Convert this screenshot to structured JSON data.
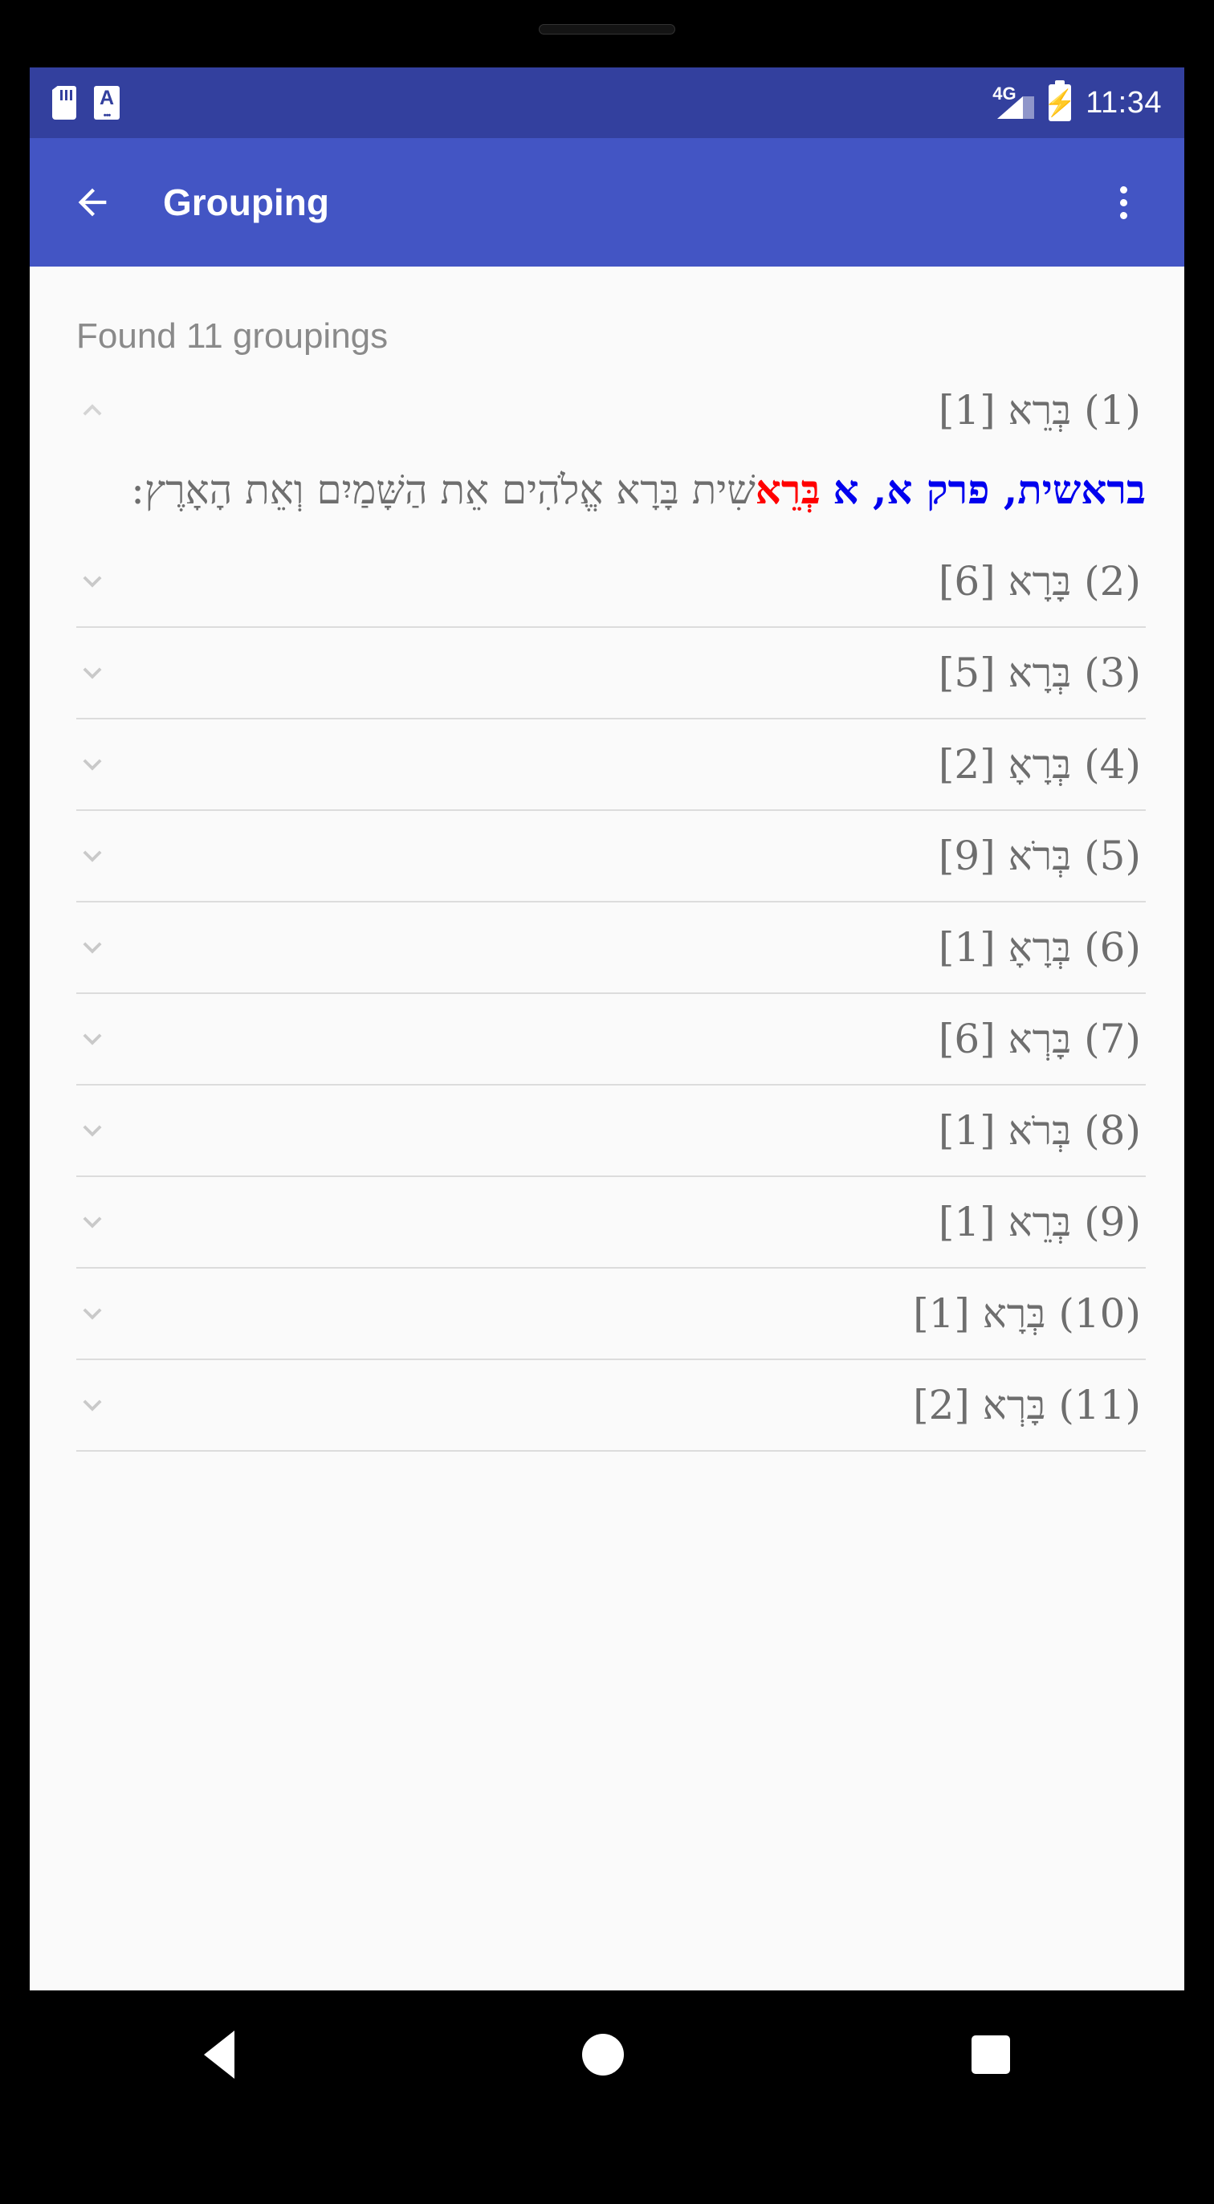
{
  "status_bar": {
    "sd_card_icon": "sd-card-icon",
    "keyboard_icon_letter": "A",
    "network_type": "4G",
    "battery_glyph": "⚡",
    "time": "11:34"
  },
  "app_bar": {
    "back_icon": "arrow-left-icon",
    "title": "Grouping",
    "overflow_icon": "more-vertical-icon"
  },
  "content": {
    "result_count_text": "Found 11 groupings"
  },
  "groupings": [
    {
      "index_label": "(1)",
      "word": "בְּרֵא",
      "count_label": "[1]",
      "expanded": true,
      "chevron": "chevron-up-icon",
      "detail": {
        "reference": "בראשית, פרק א, א",
        "highlight_word": "בְּרֵא",
        "verse_rest": "שִׁית בָּרָא אֱלֹהִים אֵת הַשָּׁמַיִם וְאֵת הָאָרֶץ:"
      }
    },
    {
      "index_label": "(2)",
      "word": "בָּרָא",
      "count_label": "[6]",
      "expanded": false,
      "chevron": "chevron-down-icon"
    },
    {
      "index_label": "(3)",
      "word": "בְּרָא",
      "count_label": "[5]",
      "expanded": false,
      "chevron": "chevron-down-icon"
    },
    {
      "index_label": "(4)",
      "word": "בְּרָאָ",
      "count_label": "[2]",
      "expanded": false,
      "chevron": "chevron-down-icon"
    },
    {
      "index_label": "(5)",
      "word": "בְּרֹא",
      "count_label": "[9]",
      "expanded": false,
      "chevron": "chevron-down-icon"
    },
    {
      "index_label": "(6)",
      "word": "בְּרָאָ",
      "count_label": "[1]",
      "expanded": false,
      "chevron": "chevron-down-icon"
    },
    {
      "index_label": "(7)",
      "word": "בָּרְא",
      "count_label": "[6]",
      "expanded": false,
      "chevron": "chevron-down-icon"
    },
    {
      "index_label": "(8)",
      "word": "בְּרֹא",
      "count_label": "[1]",
      "expanded": false,
      "chevron": "chevron-down-icon"
    },
    {
      "index_label": "(9)",
      "word": "בְּרֵא",
      "count_label": "[1]",
      "expanded": false,
      "chevron": "chevron-down-icon"
    },
    {
      "index_label": "(10)",
      "word": "בְּרָא",
      "count_label": "[1]",
      "expanded": false,
      "chevron": "chevron-down-icon"
    },
    {
      "index_label": "(11)",
      "word": "בָּרְא",
      "count_label": "[2]",
      "expanded": false,
      "chevron": "chevron-down-icon"
    }
  ],
  "nav_bar": {
    "back_icon": "triangle-back-icon",
    "home_icon": "circle-home-icon",
    "recents_icon": "square-recents-icon"
  },
  "colors": {
    "status_bar_bg": "#33409e",
    "app_bar_bg": "#4355c4",
    "content_bg": "#fafafa",
    "text_gray": "#6e6e6e",
    "reference_blue": "#0000ee",
    "highlight_red": "#ff0000",
    "divider": "#dcdcdc"
  }
}
